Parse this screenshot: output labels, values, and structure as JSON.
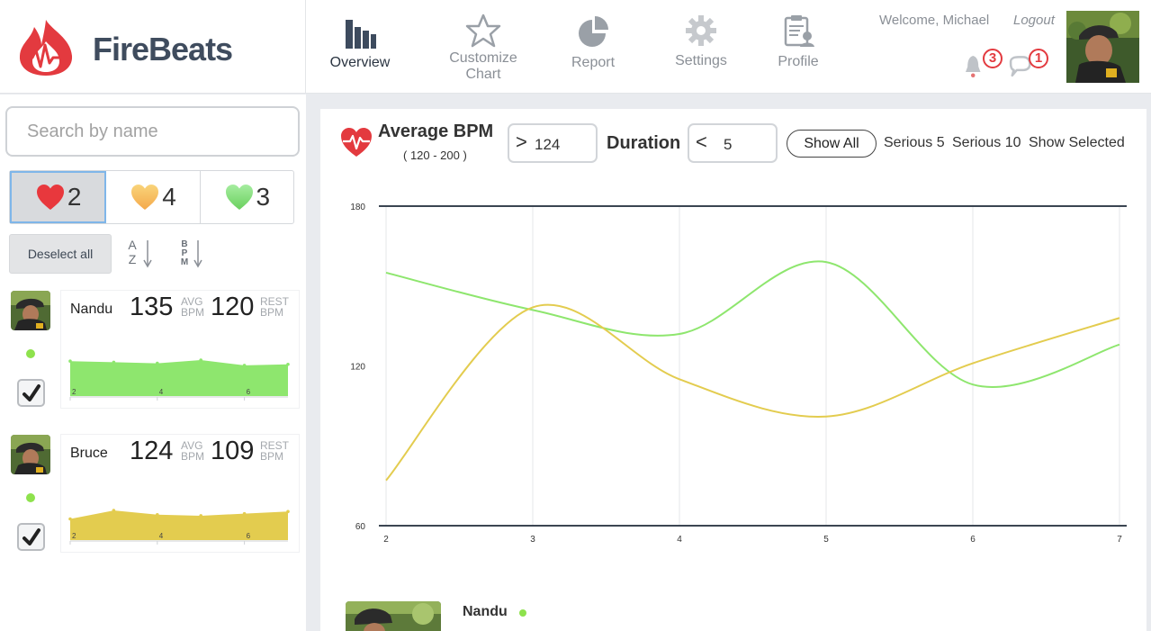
{
  "app": {
    "name": "FireBeats",
    "brand_color": "#e33a3f"
  },
  "nav": [
    {
      "label": "Overview",
      "icon": "bar-chart-icon",
      "active": true
    },
    {
      "label": "Customize\nChart",
      "icon": "star-icon",
      "active": false
    },
    {
      "label": "Report",
      "icon": "pie-chart-icon",
      "active": false
    },
    {
      "label": "Settings",
      "icon": "gear-icon",
      "active": false
    },
    {
      "label": "Profile",
      "icon": "profile-clipboard-icon",
      "active": false
    }
  ],
  "user": {
    "welcome": "Welcome, Michael",
    "logout": "Logout",
    "notifications": "3",
    "messages": "1"
  },
  "sidebar": {
    "search_placeholder": "Search by name",
    "hr_filters": [
      {
        "count": "2",
        "color": "#e8383d",
        "icon": "red-heart-icon",
        "selected": true
      },
      {
        "count": "4",
        "color": "#f7c35a",
        "icon": "orange-heart-icon",
        "selected": false
      },
      {
        "count": "3",
        "color": "#86e27a",
        "icon": "green-heart-icon",
        "selected": false
      }
    ],
    "deselect_label": "Deselect all",
    "sort_az": {
      "top": "A",
      "bottom": "Z"
    },
    "sort_bpm": {
      "letters": [
        "B",
        "P",
        "M"
      ]
    },
    "firefighters": [
      {
        "name": "Nandu",
        "avg": "135",
        "avg_label_1": "AVG",
        "avg_label_2": "BPM",
        "rest": "120",
        "rest_label_1": "REST",
        "rest_label_2": "BPM",
        "checked": true,
        "online": true,
        "spark_color": "#8ee66e",
        "spark_values": [
          123,
          122,
          121,
          124,
          119,
          120
        ],
        "spark_ticks": [
          "2",
          "4",
          "6"
        ]
      },
      {
        "name": "Bruce",
        "avg": "124",
        "avg_label_1": "AVG",
        "avg_label_2": "BPM",
        "rest": "109",
        "rest_label_1": "REST",
        "rest_label_2": "BPM",
        "checked": true,
        "online": true,
        "spark_color": "#e3cc4f",
        "spark_values": [
          110,
          118,
          114,
          113,
          115,
          117
        ],
        "spark_ticks": [
          "2",
          "4",
          "6"
        ]
      }
    ]
  },
  "main": {
    "title": "Average BPM",
    "range": "( 120 - 200 )",
    "bpm_filter": {
      "op": ">",
      "value": "124"
    },
    "duration_label": "Duration",
    "duration_filter": {
      "op": "<",
      "value": "5"
    },
    "show_all": "Show All",
    "serious5": "Serious 5",
    "serious10": "Serious 10",
    "show_selected": "Show Selected",
    "detail_name": "Nandu"
  },
  "chart_data": {
    "type": "line",
    "x": [
      2,
      3,
      4,
      5,
      6,
      7
    ],
    "ylim": [
      60,
      180
    ],
    "xlim": [
      2,
      7
    ],
    "y_ticks": [
      "60",
      "120",
      "180"
    ],
    "x_ticks": [
      "2",
      "3",
      "4",
      "5",
      "6",
      "7"
    ],
    "grid": true,
    "series": [
      {
        "color": "#8ee66e",
        "values": [
          155,
          141,
          132,
          159,
          113,
          128
        ]
      },
      {
        "color": "#e3cc4f",
        "values": [
          77,
          142,
          115,
          101,
          121,
          138
        ]
      }
    ]
  }
}
